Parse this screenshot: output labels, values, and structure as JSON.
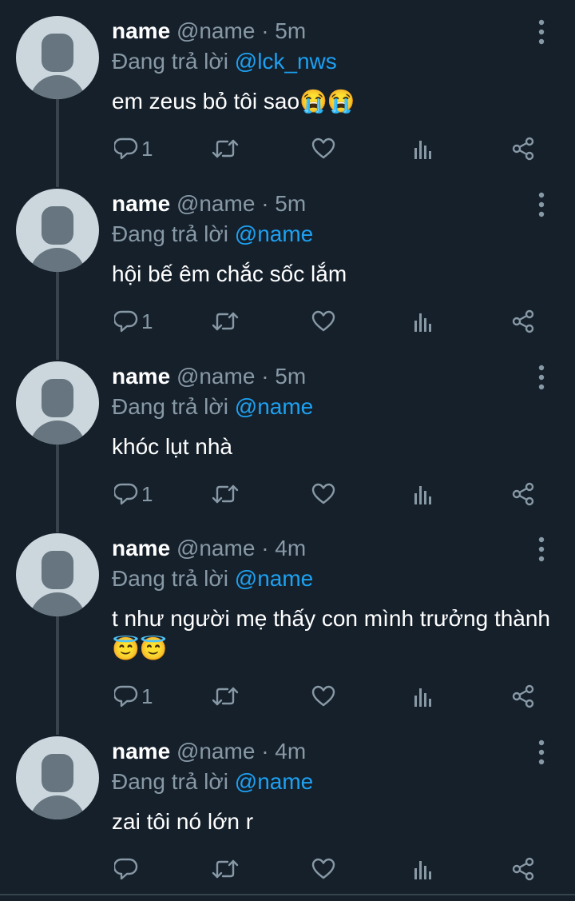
{
  "reply_prefix": "Đang trả lời",
  "colors": {
    "background": "#15202b",
    "text": "#ffffff",
    "secondary": "#8899a6",
    "mention": "#1da1f2",
    "avatar_bg": "#ccd6dd",
    "avatar_fg": "#66757f"
  },
  "icons": {
    "more": "more-vertical-icon",
    "reply": "reply-bubble-icon",
    "retweet": "retweet-icon",
    "like": "heart-icon",
    "analytics": "analytics-bars-icon",
    "share": "share-icon"
  },
  "tweets": [
    {
      "name": "name",
      "handle": "@name",
      "separator": "·",
      "time": "5m",
      "replying_to": "@lck_nws",
      "text": "em zeus bỏ tôi sao😭😭",
      "reply_count": "1"
    },
    {
      "name": "name",
      "handle": "@name",
      "separator": "·",
      "time": "5m",
      "replying_to": "@name",
      "text": "hội bế êm chắc sốc lắm",
      "reply_count": "1"
    },
    {
      "name": "name",
      "handle": "@name",
      "separator": "·",
      "time": "5m",
      "replying_to": "@name",
      "text": "khóc lụt nhà",
      "reply_count": "1"
    },
    {
      "name": "name",
      "handle": "@name",
      "separator": "·",
      "time": "4m",
      "replying_to": "@name",
      "text": "t như người mẹ thấy con mình trưởng thành😇😇",
      "reply_count": "1"
    },
    {
      "name": "name",
      "handle": "@name",
      "separator": "·",
      "time": "4m",
      "replying_to": "@name",
      "text": "zai tôi nó lớn r",
      "reply_count": ""
    }
  ]
}
